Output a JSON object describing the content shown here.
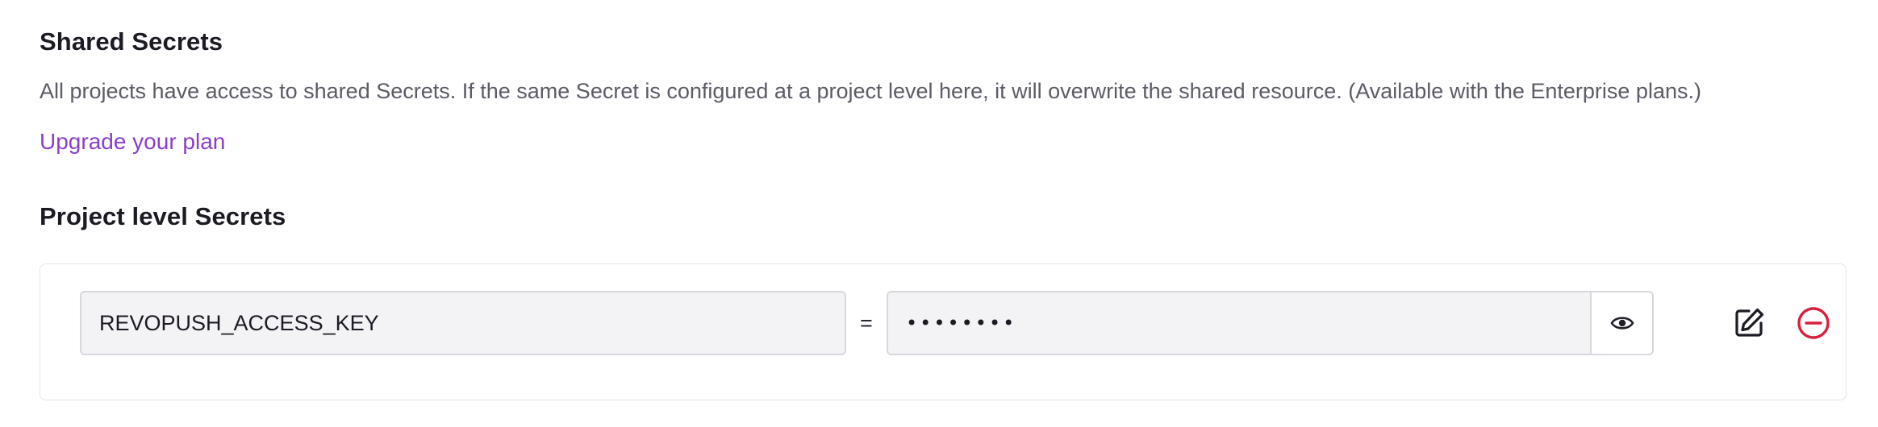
{
  "shared_secrets": {
    "title": "Shared Secrets",
    "description": "All projects have access to shared Secrets. If the same Secret is configured at a project level here, it will overwrite the shared resource. (Available with the Enterprise plans.)",
    "upgrade_link": "Upgrade your plan"
  },
  "project_secrets": {
    "title": "Project level Secrets",
    "items": [
      {
        "key": "REVOPUSH_ACCESS_KEY",
        "separator": "=",
        "masked_value": "••••••••",
        "icons": {
          "reveal": "eye-icon",
          "edit": "edit-icon",
          "remove": "remove-circle-icon"
        }
      }
    ]
  },
  "colors": {
    "link": "#8a3fc7",
    "remove": "#d81f3c",
    "text": "#1d1a24",
    "muted": "#5e5a66"
  }
}
